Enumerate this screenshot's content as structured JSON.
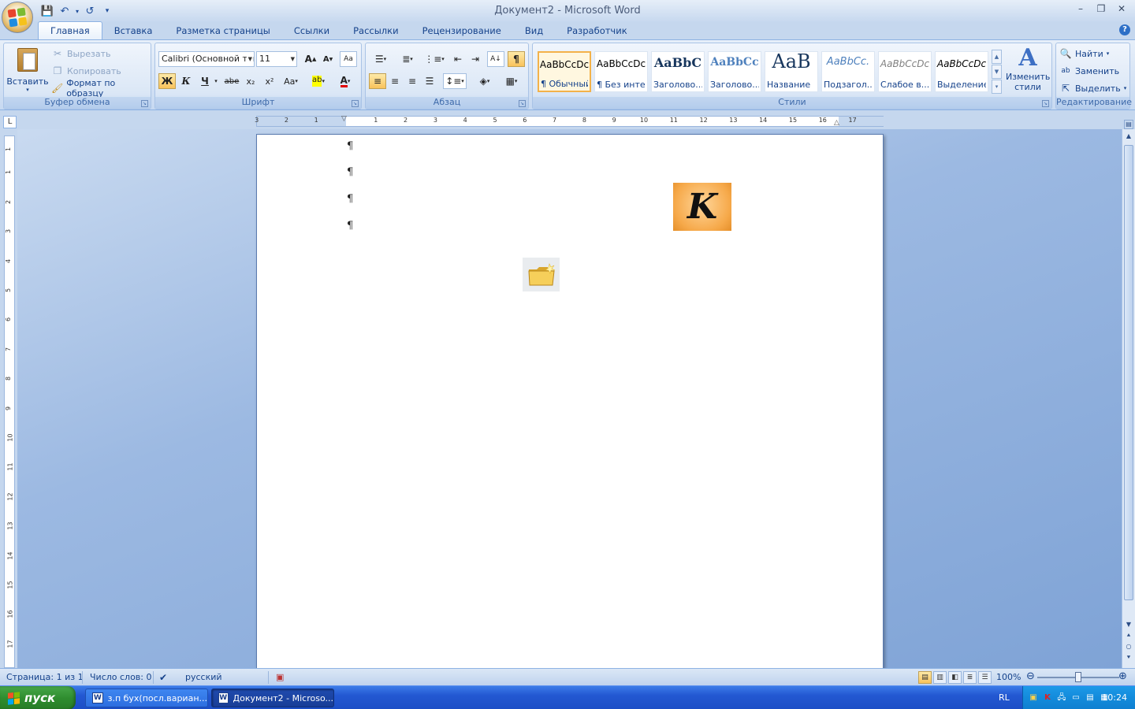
{
  "window": {
    "title": "Документ2 - Microsoft Word",
    "minimize": "–",
    "restore": "❐",
    "close": "✕"
  },
  "qat": {
    "save": "💾",
    "undo": "↶",
    "redo": "↺",
    "customize": "▾"
  },
  "tabs": [
    "Главная",
    "Вставка",
    "Разметка страницы",
    "Ссылки",
    "Рассылки",
    "Рецензирование",
    "Вид",
    "Разработчик"
  ],
  "help": "?",
  "clipboard": {
    "group_label": "Буфер обмена",
    "paste": "Вставить",
    "cut": "Вырезать",
    "copy": "Копировать",
    "format_painter": "Формат по образцу"
  },
  "font": {
    "group_label": "Шрифт",
    "font_name": "Calibri (Основной текст)",
    "font_size": "11",
    "grow": "A",
    "shrink": "A",
    "clear": "Aa",
    "bold": "Ж",
    "italic": "К",
    "underline": "Ч",
    "strike": "abe",
    "subscript": "x₂",
    "superscript": "x²",
    "change_case": "Aa",
    "highlight": "ab",
    "font_color": "A"
  },
  "paragraph": {
    "group_label": "Абзац",
    "pilcrow": "¶"
  },
  "styles": {
    "group_label": "Стили",
    "items": [
      {
        "preview": "AaBbCcDc",
        "name": "¶ Обычный"
      },
      {
        "preview": "AaBbCcDc",
        "name": "¶ Без инте..."
      },
      {
        "preview": "AaBbC",
        "name": "Заголово..."
      },
      {
        "preview": "AaBbCc",
        "name": "Заголово..."
      },
      {
        "preview": "AaB",
        "name": "Название"
      },
      {
        "preview": "AaBbCc.",
        "name": "Подзагол..."
      },
      {
        "preview": "AaBbCcDc",
        "name": "Слабое в..."
      },
      {
        "preview": "AaBbCcDc",
        "name": "Выделение"
      }
    ],
    "change_styles": "Изменить стили"
  },
  "editing": {
    "group_label": "Редактирование",
    "find": "Найти",
    "replace": "Заменить",
    "select": "Выделить"
  },
  "ruler": {
    "corner": "L",
    "h_left": [
      "3",
      "2",
      "1"
    ],
    "h_right": [
      "1",
      "2",
      "3",
      "4",
      "5",
      "6",
      "7",
      "8",
      "9",
      "10",
      "11",
      "12",
      "13",
      "14",
      "15",
      "16",
      "17"
    ],
    "v": [
      "1",
      "1",
      "2",
      "3",
      "4",
      "5",
      "6",
      "7",
      "8",
      "9",
      "10",
      "11",
      "12",
      "13",
      "14",
      "15",
      "16",
      "17"
    ]
  },
  "document": {
    "paragraph_marks": [
      "¶",
      "¶",
      "¶",
      "¶"
    ],
    "k_icon": "K"
  },
  "status": {
    "page": "Страница: 1 из 1",
    "words": "Число слов: 0",
    "language": "русский",
    "zoom": "100%",
    "zoom_level": 0.5
  },
  "taskbar": {
    "start": "пуск",
    "tasks": [
      "з.п бух(посл.вариан...",
      "Документ2 - Microso..."
    ],
    "lang": "RL",
    "clock": "10:24"
  },
  "colors": {
    "ribbon_text": "#15428b",
    "taskbar": "#2358d2",
    "start": "#2f8d2f",
    "tray": "#138bdb",
    "k_icon": "#f6a94a"
  }
}
